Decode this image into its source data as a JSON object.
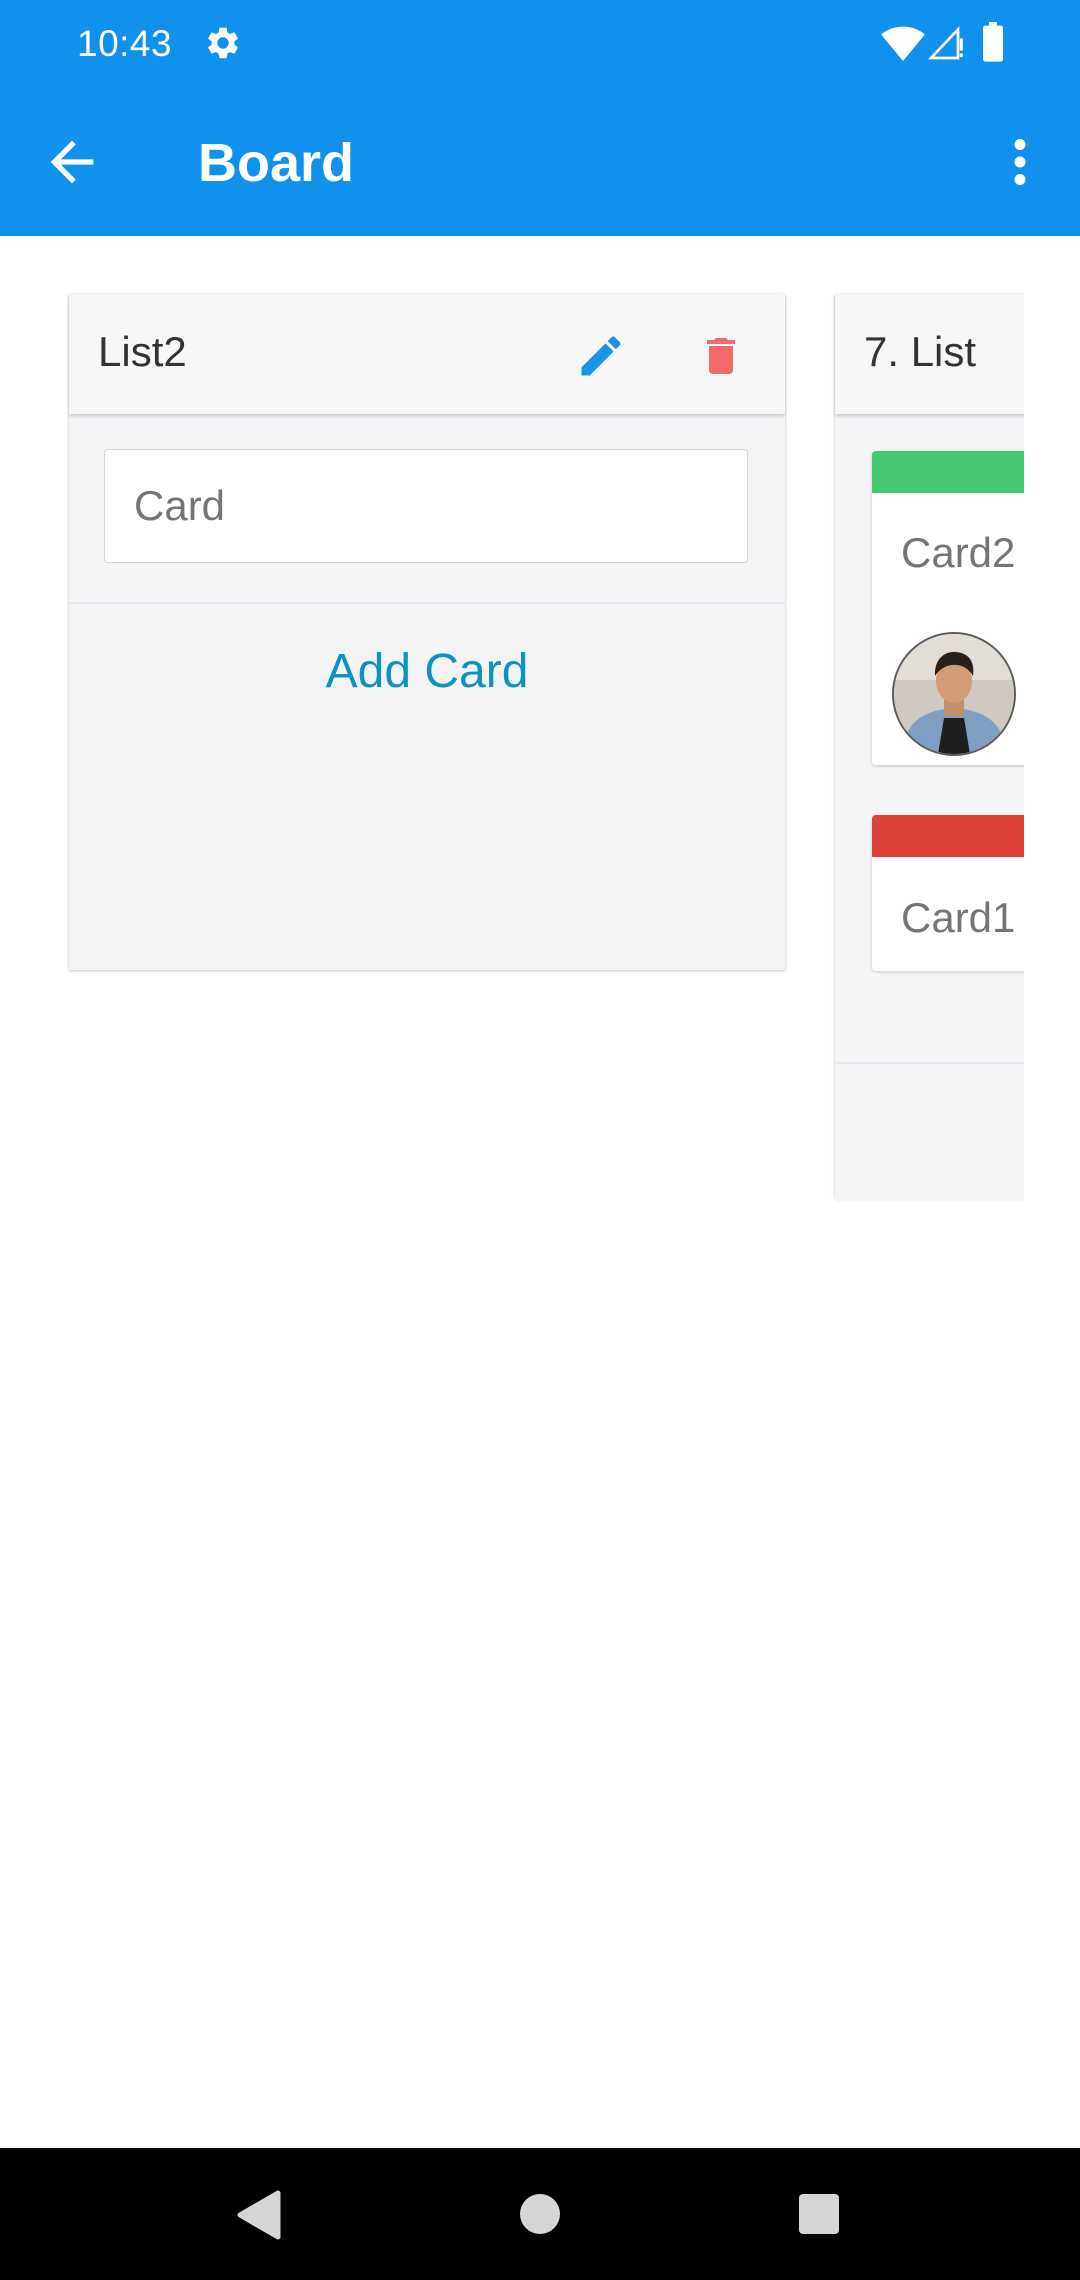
{
  "status_bar": {
    "time": "10:43",
    "icons": [
      "gear-icon",
      "wifi-icon",
      "signal-icon",
      "battery-icon"
    ]
  },
  "app_bar": {
    "title": "Board",
    "back_icon": "arrow-left-icon",
    "menu_icon": "more-vertical-icon"
  },
  "lists": [
    {
      "title": "List2",
      "edit_icon": "pencil-icon",
      "delete_icon": "trash-icon",
      "card_input": {
        "placeholder": "Card",
        "value": ""
      },
      "add_card_label": "Add Card"
    },
    {
      "title": "7. List",
      "cards": [
        {
          "title": "Card2",
          "label_color": "#44c770",
          "has_avatar": true
        },
        {
          "title": "Card1",
          "label_color": "#dc4238",
          "has_avatar": false
        }
      ]
    }
  ],
  "colors": {
    "primary": "#0f91ec",
    "edit_icon": "#1793e8",
    "delete_icon": "#f46a6a",
    "add_card_text": "#0d93c2"
  },
  "nav_bar": {
    "icons": [
      "nav-back-icon",
      "nav-home-icon",
      "nav-recents-icon"
    ]
  }
}
